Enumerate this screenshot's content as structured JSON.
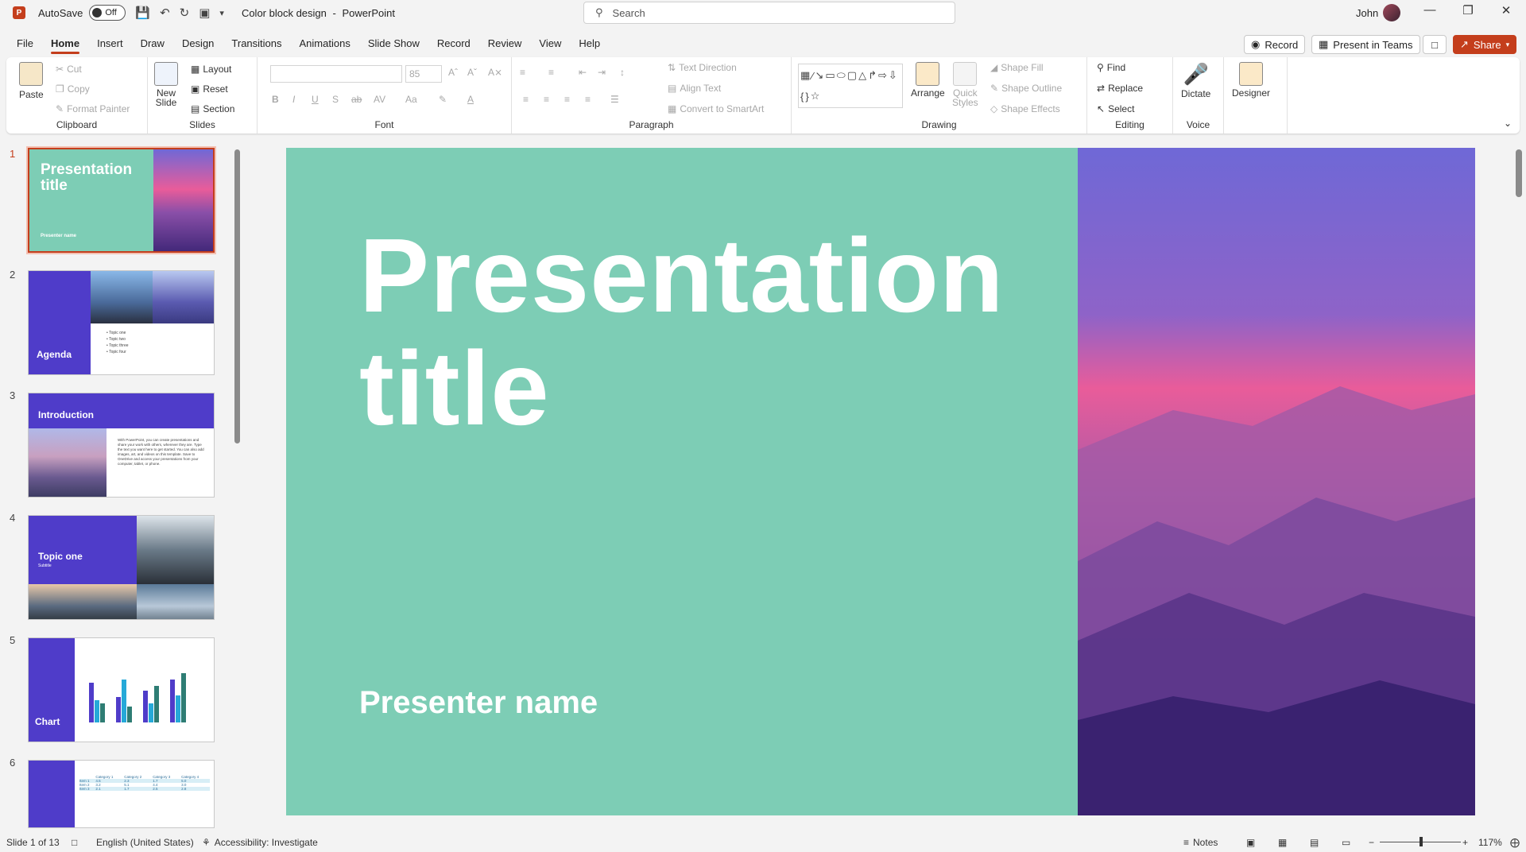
{
  "app": {
    "logo_letter": "P",
    "autosave_label": "AutoSave",
    "autosave_state": "Off",
    "doc_title": "Color block design",
    "app_name": "PowerPoint",
    "title_separator": "-",
    "search_placeholder": "Search",
    "user_name": "John"
  },
  "menu": {
    "tabs": [
      "File",
      "Home",
      "Insert",
      "Draw",
      "Design",
      "Transitions",
      "Animations",
      "Slide Show",
      "Record",
      "Review",
      "View",
      "Help"
    ],
    "active": "Home",
    "record_btn": "Record",
    "teams_btn": "Present in Teams",
    "share_btn": "Share"
  },
  "ribbon": {
    "clipboard": {
      "label": "Clipboard",
      "paste": "Paste",
      "cut": "Cut",
      "copy": "Copy",
      "format_painter": "Format Painter"
    },
    "slides": {
      "label": "Slides",
      "new_slide": "New",
      "new_slide_2": "Slide",
      "layout": "Layout",
      "reset": "Reset",
      "section": "Section"
    },
    "font": {
      "label": "Font",
      "size": "85",
      "bold": "B",
      "italic": "I",
      "underline": "U",
      "shadow": "S",
      "strike": "ab",
      "spacing": "AV",
      "case": "Aa",
      "color": "A"
    },
    "paragraph": {
      "label": "Paragraph",
      "text_direction": "Text Direction",
      "align_text": "Align Text",
      "convert_smartart": "Convert to SmartArt"
    },
    "drawing": {
      "label": "Drawing",
      "arrange": "Arrange",
      "quick_styles": "Quick",
      "quick_styles_2": "Styles",
      "shape_fill": "Shape Fill",
      "shape_outline": "Shape Outline",
      "shape_effects": "Shape Effects"
    },
    "editing": {
      "label": "Editing",
      "find": "Find",
      "replace": "Replace",
      "select": "Select"
    },
    "voice": {
      "label": "Voice",
      "dictate": "Dictate"
    },
    "designer": {
      "label": "Designer"
    }
  },
  "thumbnails": [
    {
      "num": "1",
      "title": "Presentation title",
      "sub": "Presenter name"
    },
    {
      "num": "2",
      "title": "Agenda",
      "bullets": [
        "Topic one",
        "Topic two",
        "Topic three",
        "Topic four"
      ]
    },
    {
      "num": "3",
      "title": "Introduction",
      "body": "With PowerPoint, you can create presentations and share your work with others, wherever they are. Type the text you want here to get started. You can also add images, art, and videos on this template. Save to OneDrive and access your presentations from your computer, tablet, or phone."
    },
    {
      "num": "4",
      "title": "Topic one",
      "sub": "Subtitle"
    },
    {
      "num": "5",
      "title": "Chart"
    },
    {
      "num": "6",
      "headers": [
        "Category 1",
        "Category 2",
        "Category 3",
        "Category 4"
      ],
      "rows": [
        [
          "Item 1",
          "4.5",
          "2.3",
          "1.7",
          "5.0"
        ],
        [
          "Item 2",
          "3.2",
          "5.1",
          "4.4",
          "3.0"
        ],
        [
          "Item 3",
          "2.1",
          "1.7",
          "2.5",
          "2.8"
        ]
      ]
    }
  ],
  "slide": {
    "title": "Presentation title",
    "presenter": "Presenter name",
    "bg_color": "#7dcdb5"
  },
  "status": {
    "slide_of": "Slide 1 of 13",
    "language": "English (United States)",
    "accessibility": "Accessibility: Investigate",
    "notes": "Notes",
    "zoom": "117%"
  },
  "colors": {
    "accent": "#c43e1c",
    "indigo": "#4f3cc9",
    "teal": "#7dcdb5"
  }
}
